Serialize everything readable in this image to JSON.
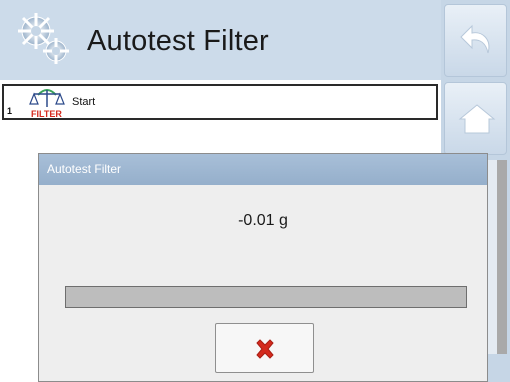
{
  "header": {
    "title": "Autotest Filter",
    "icon": "gears-icon"
  },
  "list": {
    "items": [
      {
        "number": "1",
        "icon": "filter-scale-icon",
        "icon_text": "FILTER",
        "label": "Start"
      }
    ]
  },
  "side_panel": {
    "buttons": [
      "back-arrow-icon",
      "home-icon"
    ]
  },
  "dialog": {
    "title": "Autotest Filter",
    "value": "-0.01 g",
    "progress_fraction": 0.0,
    "cancel_icon": "close-x-icon"
  },
  "colors": {
    "accent": "#ccdbea",
    "dialog_header": "#9fb8d3",
    "cancel_x": "#d42a1e"
  }
}
